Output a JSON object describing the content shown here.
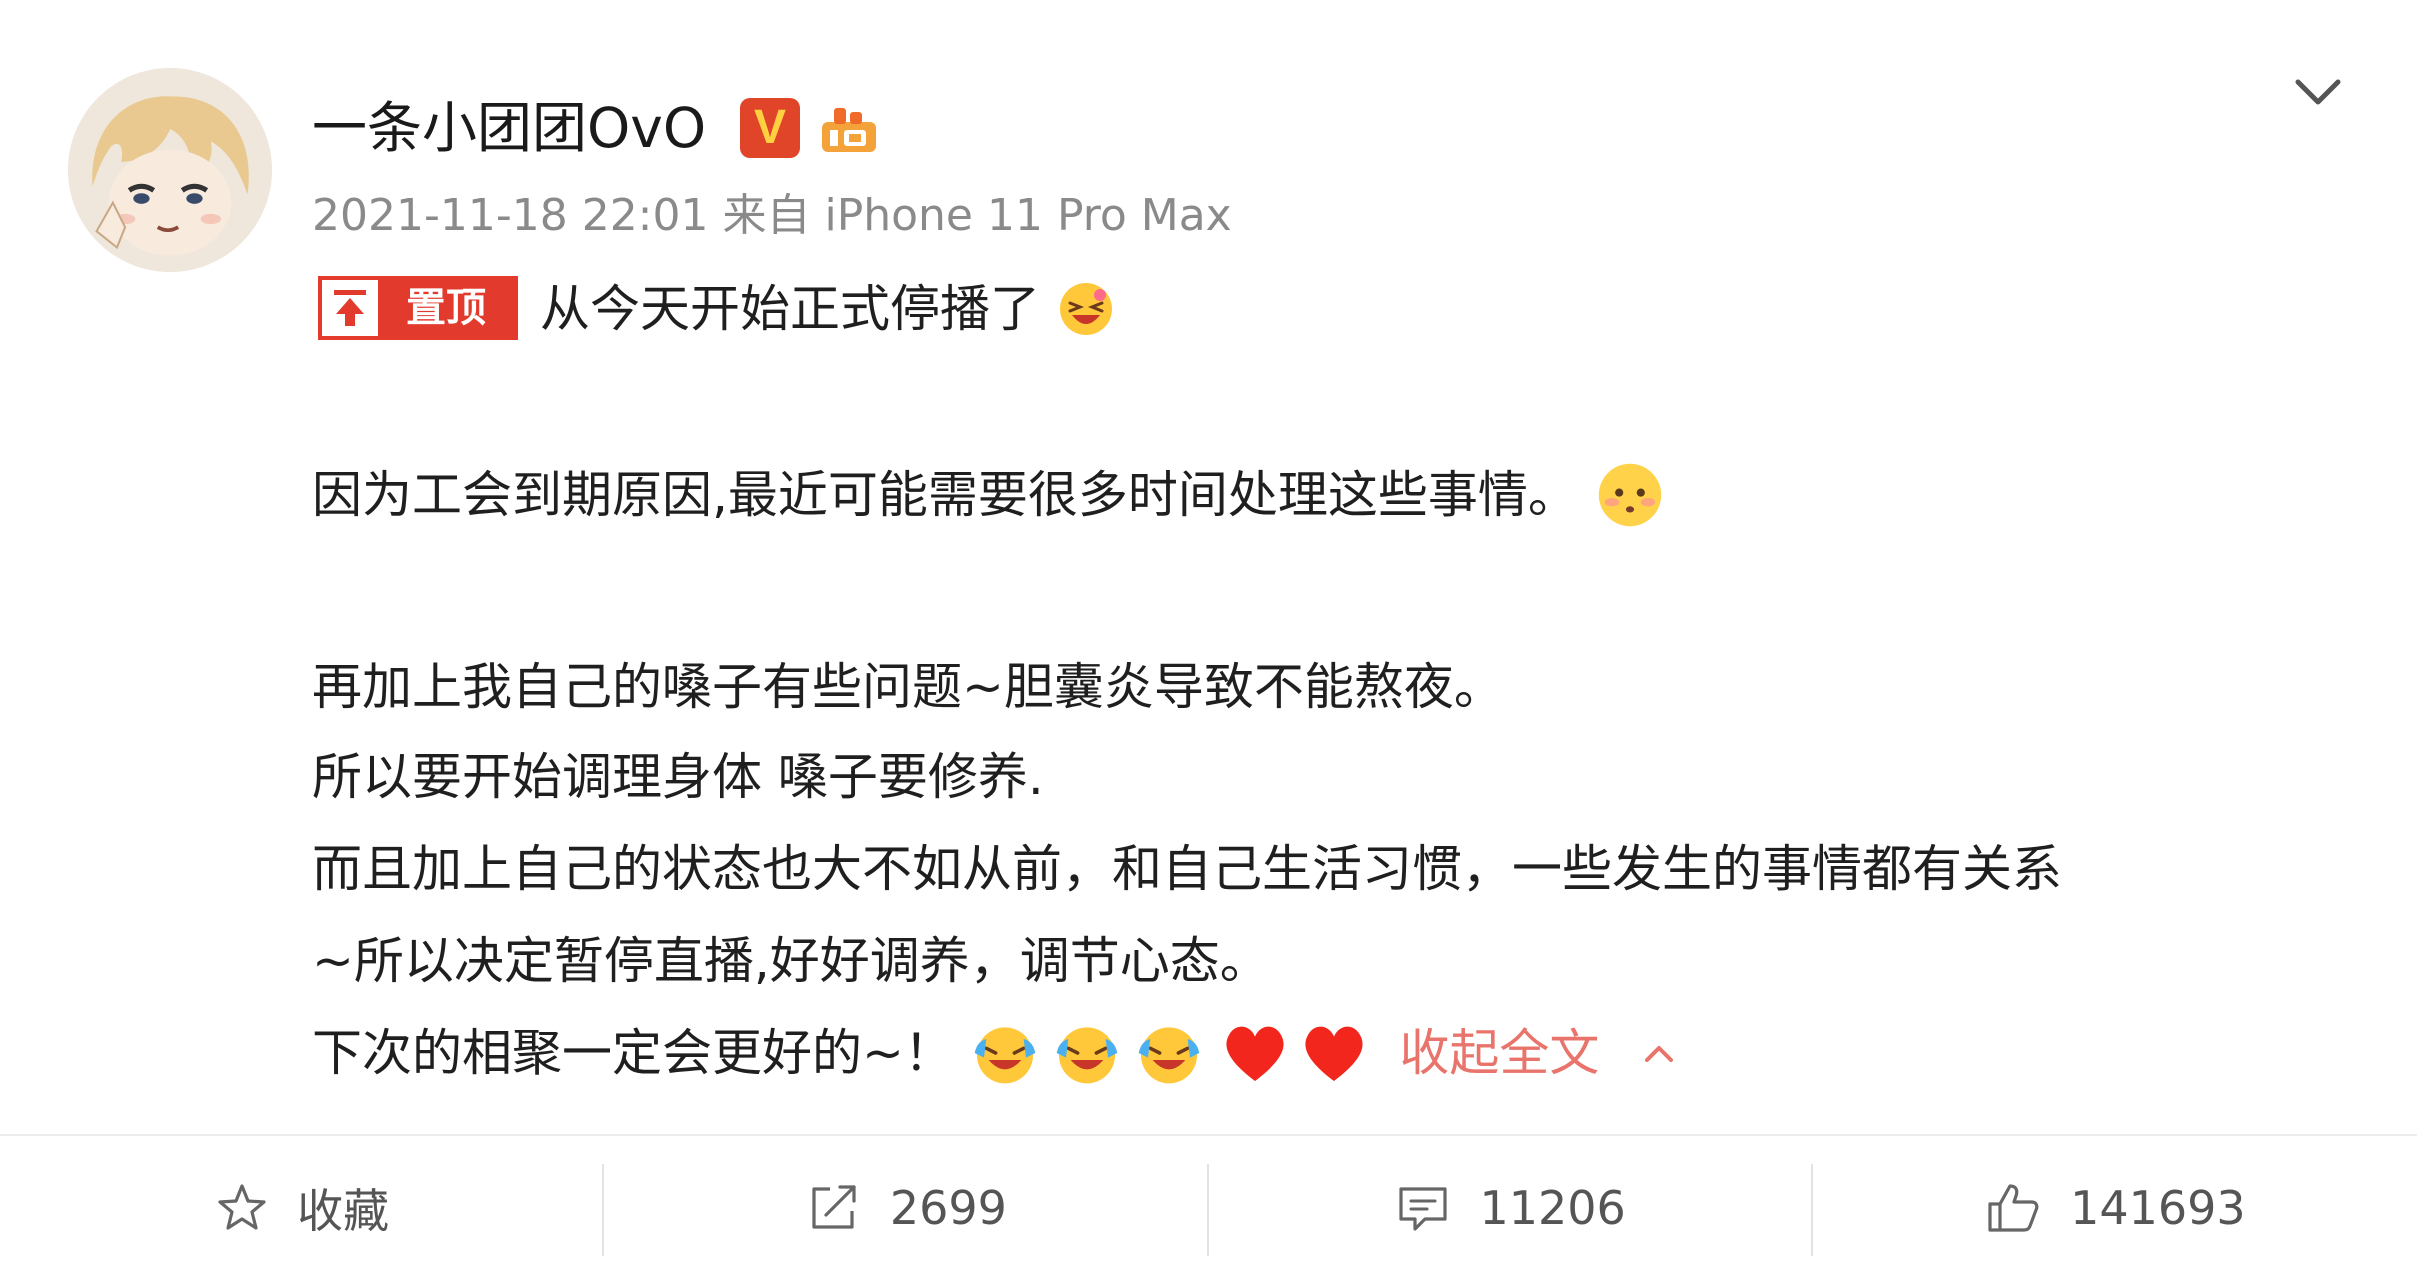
{
  "post": {
    "username": "一条小团团OvO",
    "vip_mark": "V",
    "meta": "2021-11-18 22:01 来自 iPhone 11 Pro Max",
    "pin_label": "置顶",
    "lines": [
      "从今天开始正式停播了",
      "因为工会到期原因,最近可能需要很多时间处理这些事情。",
      "再加上我自己的嗓子有些问题~胆囊炎导致不能熬夜。",
      "所以要开始调理身体 嗓子要修养.",
      "而且加上自己的状态也大不如从前，和自己生活习惯，一些发生的事情都有关系",
      "~所以决定暂停直播,好好调养，调节心态。",
      "下次的相聚一定会更好的~！"
    ],
    "collapse_label": "收起全文"
  },
  "actions": {
    "favorite_label": "收藏",
    "repost_count": "2699",
    "comment_count": "11206",
    "like_count": "141693"
  },
  "colors": {
    "accent": "#e23a2c",
    "link": "#e8746b",
    "meta_text": "#8a8a8a"
  },
  "icons": [
    "chevron-down-icon",
    "star-icon",
    "share-icon",
    "comment-icon",
    "thumbs-up-icon",
    "heart-icon",
    "laughing-emoji-icon",
    "blushing-emoji-icon",
    "crying-laugh-emoji-icon"
  ]
}
